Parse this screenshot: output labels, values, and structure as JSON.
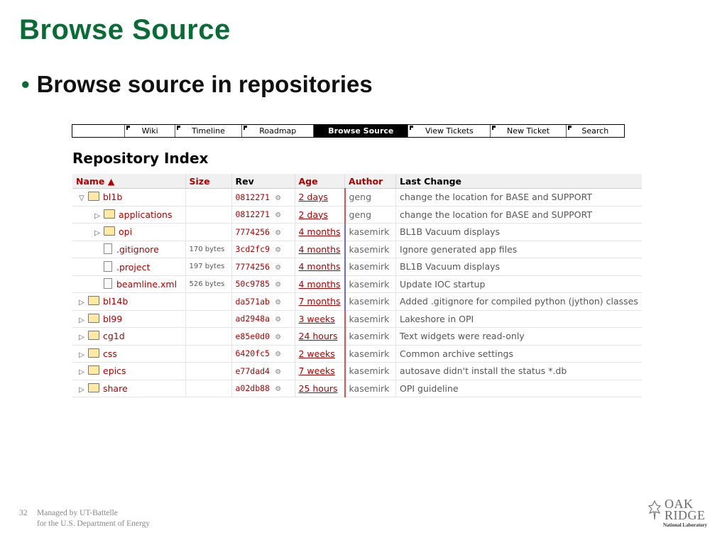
{
  "slide": {
    "title": "Browse Source",
    "bullet": "Browse source in repositories"
  },
  "nav": {
    "tabs": [
      "",
      "Wiki",
      "Timeline",
      "Roadmap",
      "Browse Source",
      "View Tickets",
      "New Ticket",
      "Search"
    ],
    "active": "Browse Source"
  },
  "repo": {
    "heading": "Repository Index",
    "columns": {
      "name": "Name ▲",
      "size": "Size",
      "rev": "Rev",
      "age": "Age",
      "author": "Author",
      "change": "Last Change"
    },
    "rows": [
      {
        "name": "bl1b",
        "type": "folder",
        "state": "open",
        "indent": 0,
        "size": "",
        "rev": "0812271",
        "age": "2 days",
        "author": "geng",
        "change": "change the location for BASE and SUPPORT"
      },
      {
        "name": "applications",
        "type": "folder",
        "state": "closed",
        "indent": 1,
        "size": "",
        "rev": "0812271",
        "age": "2 days",
        "author": "geng",
        "change": "change the location for BASE and SUPPORT"
      },
      {
        "name": "opi",
        "type": "folder",
        "state": "closed",
        "indent": 1,
        "size": "",
        "rev": "7774256",
        "age": "4 months",
        "author": "kasemirk",
        "change": "BL1B Vacuum displays"
      },
      {
        "name": ".gitignore",
        "type": "file",
        "state": "",
        "indent": 1,
        "size": "170 bytes",
        "rev": "3cd2fc9",
        "age": "4 months",
        "author": "kasemirk",
        "change": "Ignore generated app files"
      },
      {
        "name": ".project",
        "type": "file",
        "state": "",
        "indent": 1,
        "size": "197 bytes",
        "rev": "7774256",
        "age": "4 months",
        "author": "kasemirk",
        "change": "BL1B Vacuum displays"
      },
      {
        "name": "beamline.xml",
        "type": "file",
        "state": "",
        "indent": 1,
        "size": "526 bytes",
        "rev": "50c9785",
        "age": "4 months",
        "author": "kasemirk",
        "change": "Update IOC startup"
      },
      {
        "name": "bl14b",
        "type": "folder",
        "state": "closed",
        "indent": 0,
        "size": "",
        "rev": "da571ab",
        "age": "7 months",
        "author": "kasemirk",
        "change": "Added .gitignore for compiled python (jython) classes"
      },
      {
        "name": "bl99",
        "type": "folder",
        "state": "closed",
        "indent": 0,
        "size": "",
        "rev": "ad2948a",
        "age": "3 weeks",
        "author": "kasemirk",
        "change": "Lakeshore in OPI"
      },
      {
        "name": "cg1d",
        "type": "folder",
        "state": "closed",
        "indent": 0,
        "size": "",
        "rev": "e85e0d0",
        "age": "24 hours",
        "author": "kasemirk",
        "change": "Text widgets were read-only"
      },
      {
        "name": "css",
        "type": "folder",
        "state": "closed",
        "indent": 0,
        "size": "",
        "rev": "6420fc5",
        "age": "2 weeks",
        "author": "kasemirk",
        "change": "Common archive settings"
      },
      {
        "name": "epics",
        "type": "folder",
        "state": "closed",
        "indent": 0,
        "size": "",
        "rev": "e77dad4",
        "age": "7 weeks",
        "author": "kasemirk",
        "change": "autosave didn't install the status *.db"
      },
      {
        "name": "share",
        "type": "folder",
        "state": "closed",
        "indent": 0,
        "size": "",
        "rev": "a02db88",
        "age": "25 hours",
        "author": "kasemirk",
        "change": "OPI guideline"
      }
    ],
    "age_colors": [
      "#e05050",
      "#e05050",
      "#6a6ae0",
      "#6a6ae0",
      "#6a6ae0",
      "#6a6ae0",
      "#6a6ae0",
      "#e05050",
      "#e05050",
      "#e05050",
      "#e05050",
      "#e05050"
    ]
  },
  "footer": {
    "page": "32",
    "line1": "Managed by UT-Battelle",
    "line2": "for the U.S. Department of Energy"
  },
  "logo": {
    "oak": "OAK",
    "ridge": "RIDGE",
    "sub": "National Laboratory"
  },
  "colors": {
    "title": "#0b6b36",
    "link": "#b00000"
  }
}
